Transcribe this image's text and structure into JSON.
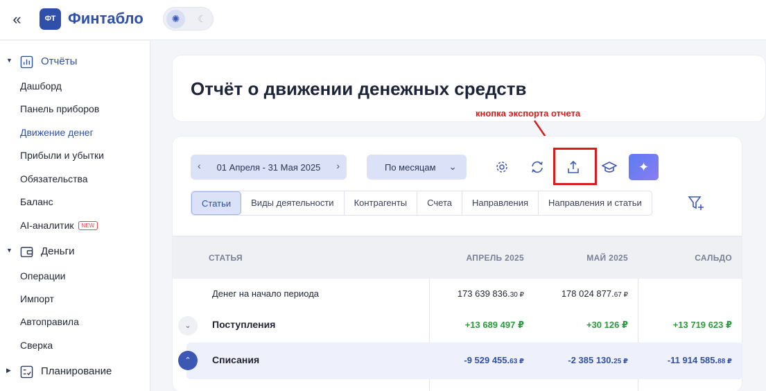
{
  "header": {
    "collapse_icon": "double-chevron-left-icon",
    "logo_badge": "ФТ",
    "logo_text": "Финтабло",
    "theme": {
      "light_icon": "sun-icon",
      "dark_icon": "moon-icon",
      "active": "light"
    }
  },
  "sidebar": {
    "sections": [
      {
        "label": "Отчёты",
        "icon": "chart-icon",
        "expanded": true,
        "active": true,
        "items": [
          {
            "label": "Дашборд"
          },
          {
            "label": "Панель приборов"
          },
          {
            "label": "Движение денег",
            "active": true
          },
          {
            "label": "Прибыли и убытки"
          },
          {
            "label": "Обязательства"
          },
          {
            "label": "Баланс"
          },
          {
            "label": "AI-аналитик",
            "badge": "NEW"
          }
        ]
      },
      {
        "label": "Деньги",
        "icon": "wallet-icon",
        "expanded": true,
        "items": [
          {
            "label": "Операции"
          },
          {
            "label": "Импорт"
          },
          {
            "label": "Автоправила"
          },
          {
            "label": "Сверка"
          }
        ]
      },
      {
        "label": "Планирование",
        "icon": "checklist-icon",
        "expanded": false,
        "items": []
      }
    ]
  },
  "page": {
    "title": "Отчёт о движении денежных средств"
  },
  "annotation": {
    "text": "кнопка экспорта отчета",
    "color": "#d81b1b"
  },
  "toolbar": {
    "date_range": "01 Апреля - 31 Мая 2025",
    "period": "По месяцам",
    "buttons": [
      "settings-gear-icon",
      "refresh-icon",
      "export-upload-icon",
      "graduation-cap-icon",
      "ai-sparkle-icon"
    ]
  },
  "tabs": [
    {
      "label": "Статьи",
      "active": true
    },
    {
      "label": "Виды деятельности"
    },
    {
      "label": "Контрагенты"
    },
    {
      "label": "Счета"
    },
    {
      "label": "Направления"
    },
    {
      "label": "Направления и статьи"
    }
  ],
  "table": {
    "columns": [
      "СТАТЬЯ",
      "АПРЕЛЬ 2025",
      "МАЙ 2025",
      "САЛЬДО"
    ],
    "rows": [
      {
        "label": "Денег на начало периода",
        "values": [
          {
            "main": "173 639 836.",
            "frac": "30 ₽"
          },
          {
            "main": "178 024 877.",
            "frac": "67 ₽"
          },
          {
            "main": "",
            "frac": ""
          }
        ]
      },
      {
        "label": "Поступления",
        "toggle": "collapsed",
        "values": [
          {
            "main": "+13 689 497 ₽",
            "frac": ""
          },
          {
            "main": "+30 126 ₽",
            "frac": ""
          },
          {
            "main": "+13 719 623 ₽",
            "frac": ""
          }
        ]
      },
      {
        "label": "Списания",
        "toggle": "expanded",
        "values": [
          {
            "main": "-9 529 455.",
            "frac": "63 ₽"
          },
          {
            "main": "-2 385 130.",
            "frac": "25 ₽"
          },
          {
            "main": "-11 914 585.",
            "frac": "88 ₽"
          }
        ]
      }
    ]
  },
  "colors": {
    "brand": "#2f4fa8",
    "positive": "#2c9a3e",
    "highlight": "#d81b1b"
  }
}
